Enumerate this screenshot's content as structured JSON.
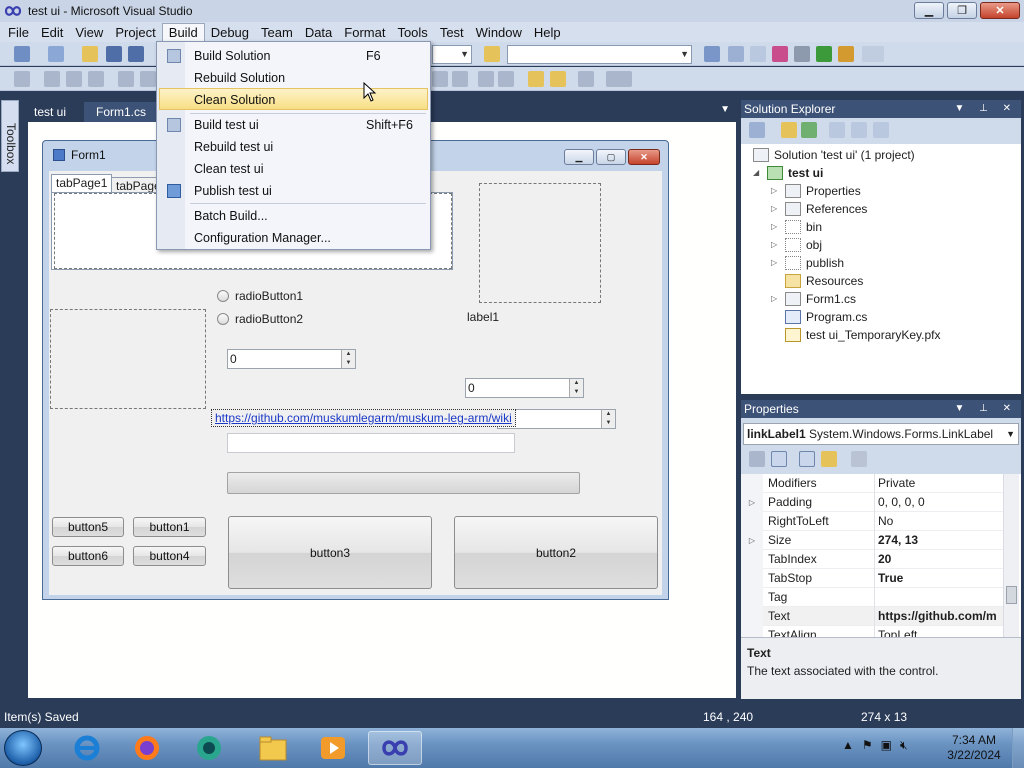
{
  "window": {
    "title": "test ui - Microsoft Visual Studio"
  },
  "menubar": [
    "File",
    "Edit",
    "View",
    "Project",
    "Build",
    "Debug",
    "Team",
    "Data",
    "Format",
    "Tools",
    "Test",
    "Window",
    "Help"
  ],
  "menubar_active": "Build",
  "build_menu": {
    "build_solution": {
      "label": "Build Solution",
      "shortcut": "F6"
    },
    "rebuild_solution": {
      "label": "Rebuild Solution"
    },
    "clean_solution": {
      "label": "Clean Solution"
    },
    "build_project": {
      "label": "Build test ui",
      "shortcut": "Shift+F6"
    },
    "rebuild_project": {
      "label": "Rebuild test ui"
    },
    "clean_project": {
      "label": "Clean test ui"
    },
    "publish_project": {
      "label": "Publish test ui"
    },
    "batch_build": {
      "label": "Batch Build..."
    },
    "config_manager": {
      "label": "Configuration Manager..."
    }
  },
  "toolbox_label": "Toolbox",
  "doc_tabs": [
    "test ui",
    "Form1.cs"
  ],
  "form": {
    "title": "Form1",
    "tab1": "tabPage1",
    "tab2": "tabPage",
    "radio1": "radioButton1",
    "radio2": "radioButton2",
    "label1": "label1",
    "numeric1": "0",
    "numeric2": "0",
    "numeric3": "0",
    "link": "https://github.com/muskumlegarm/muskum-leg-arm/wiki",
    "button1": "button1",
    "button2": "button2",
    "button3": "button3",
    "button4": "button4",
    "button5": "button5",
    "button6": "button6"
  },
  "solution_explorer": {
    "title": "Solution Explorer",
    "items": [
      {
        "label": "Solution 'test ui' (1 project)"
      },
      {
        "label": "test ui"
      },
      {
        "label": "Properties"
      },
      {
        "label": "References"
      },
      {
        "label": "bin"
      },
      {
        "label": "obj"
      },
      {
        "label": "publish"
      },
      {
        "label": "Resources"
      },
      {
        "label": "Form1.cs"
      },
      {
        "label": "Program.cs"
      },
      {
        "label": "test ui_TemporaryKey.pfx"
      }
    ]
  },
  "properties": {
    "title": "Properties",
    "object_name": "linkLabel1",
    "object_type": "System.Windows.Forms.LinkLabel",
    "rows": [
      {
        "name": "Modifiers",
        "value": "Private"
      },
      {
        "name": "Padding",
        "value": "0, 0, 0, 0"
      },
      {
        "name": "RightToLeft",
        "value": "No"
      },
      {
        "name": "Size",
        "value": "274, 13"
      },
      {
        "name": "TabIndex",
        "value": "20"
      },
      {
        "name": "TabStop",
        "value": "True"
      },
      {
        "name": "Tag",
        "value": ""
      },
      {
        "name": "Text",
        "value": "https://github.com/m"
      },
      {
        "name": "TextAlign",
        "value": "TopLeft"
      }
    ],
    "desc_title": "Text",
    "desc_text": "The text associated with the control."
  },
  "statusbar": {
    "message": "Item(s) Saved",
    "position": "164 , 240",
    "size": "274 x 13"
  },
  "clock": {
    "time": "7:34 AM",
    "date": "3/22/2024"
  },
  "colors": {
    "vs_dark": "#2b3c59",
    "link_blue": "#1a39c8",
    "menu_hover": "#f8df85"
  }
}
